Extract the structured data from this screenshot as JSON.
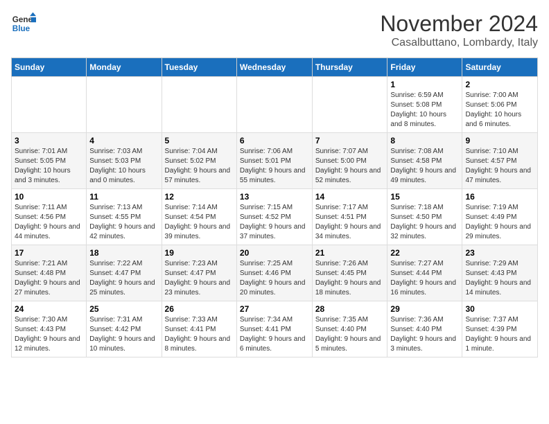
{
  "logo": {
    "line1": "General",
    "line2": "Blue"
  },
  "header": {
    "title": "November 2024",
    "subtitle": "Casalbuttano, Lombardy, Italy"
  },
  "weekdays": [
    "Sunday",
    "Monday",
    "Tuesday",
    "Wednesday",
    "Thursday",
    "Friday",
    "Saturday"
  ],
  "weeks": [
    [
      {
        "day": "",
        "info": ""
      },
      {
        "day": "",
        "info": ""
      },
      {
        "day": "",
        "info": ""
      },
      {
        "day": "",
        "info": ""
      },
      {
        "day": "",
        "info": ""
      },
      {
        "day": "1",
        "info": "Sunrise: 6:59 AM\nSunset: 5:08 PM\nDaylight: 10 hours and 8 minutes."
      },
      {
        "day": "2",
        "info": "Sunrise: 7:00 AM\nSunset: 5:06 PM\nDaylight: 10 hours and 6 minutes."
      }
    ],
    [
      {
        "day": "3",
        "info": "Sunrise: 7:01 AM\nSunset: 5:05 PM\nDaylight: 10 hours and 3 minutes."
      },
      {
        "day": "4",
        "info": "Sunrise: 7:03 AM\nSunset: 5:03 PM\nDaylight: 10 hours and 0 minutes."
      },
      {
        "day": "5",
        "info": "Sunrise: 7:04 AM\nSunset: 5:02 PM\nDaylight: 9 hours and 57 minutes."
      },
      {
        "day": "6",
        "info": "Sunrise: 7:06 AM\nSunset: 5:01 PM\nDaylight: 9 hours and 55 minutes."
      },
      {
        "day": "7",
        "info": "Sunrise: 7:07 AM\nSunset: 5:00 PM\nDaylight: 9 hours and 52 minutes."
      },
      {
        "day": "8",
        "info": "Sunrise: 7:08 AM\nSunset: 4:58 PM\nDaylight: 9 hours and 49 minutes."
      },
      {
        "day": "9",
        "info": "Sunrise: 7:10 AM\nSunset: 4:57 PM\nDaylight: 9 hours and 47 minutes."
      }
    ],
    [
      {
        "day": "10",
        "info": "Sunrise: 7:11 AM\nSunset: 4:56 PM\nDaylight: 9 hours and 44 minutes."
      },
      {
        "day": "11",
        "info": "Sunrise: 7:13 AM\nSunset: 4:55 PM\nDaylight: 9 hours and 42 minutes."
      },
      {
        "day": "12",
        "info": "Sunrise: 7:14 AM\nSunset: 4:54 PM\nDaylight: 9 hours and 39 minutes."
      },
      {
        "day": "13",
        "info": "Sunrise: 7:15 AM\nSunset: 4:52 PM\nDaylight: 9 hours and 37 minutes."
      },
      {
        "day": "14",
        "info": "Sunrise: 7:17 AM\nSunset: 4:51 PM\nDaylight: 9 hours and 34 minutes."
      },
      {
        "day": "15",
        "info": "Sunrise: 7:18 AM\nSunset: 4:50 PM\nDaylight: 9 hours and 32 minutes."
      },
      {
        "day": "16",
        "info": "Sunrise: 7:19 AM\nSunset: 4:49 PM\nDaylight: 9 hours and 29 minutes."
      }
    ],
    [
      {
        "day": "17",
        "info": "Sunrise: 7:21 AM\nSunset: 4:48 PM\nDaylight: 9 hours and 27 minutes."
      },
      {
        "day": "18",
        "info": "Sunrise: 7:22 AM\nSunset: 4:47 PM\nDaylight: 9 hours and 25 minutes."
      },
      {
        "day": "19",
        "info": "Sunrise: 7:23 AM\nSunset: 4:47 PM\nDaylight: 9 hours and 23 minutes."
      },
      {
        "day": "20",
        "info": "Sunrise: 7:25 AM\nSunset: 4:46 PM\nDaylight: 9 hours and 20 minutes."
      },
      {
        "day": "21",
        "info": "Sunrise: 7:26 AM\nSunset: 4:45 PM\nDaylight: 9 hours and 18 minutes."
      },
      {
        "day": "22",
        "info": "Sunrise: 7:27 AM\nSunset: 4:44 PM\nDaylight: 9 hours and 16 minutes."
      },
      {
        "day": "23",
        "info": "Sunrise: 7:29 AM\nSunset: 4:43 PM\nDaylight: 9 hours and 14 minutes."
      }
    ],
    [
      {
        "day": "24",
        "info": "Sunrise: 7:30 AM\nSunset: 4:43 PM\nDaylight: 9 hours and 12 minutes."
      },
      {
        "day": "25",
        "info": "Sunrise: 7:31 AM\nSunset: 4:42 PM\nDaylight: 9 hours and 10 minutes."
      },
      {
        "day": "26",
        "info": "Sunrise: 7:33 AM\nSunset: 4:41 PM\nDaylight: 9 hours and 8 minutes."
      },
      {
        "day": "27",
        "info": "Sunrise: 7:34 AM\nSunset: 4:41 PM\nDaylight: 9 hours and 6 minutes."
      },
      {
        "day": "28",
        "info": "Sunrise: 7:35 AM\nSunset: 4:40 PM\nDaylight: 9 hours and 5 minutes."
      },
      {
        "day": "29",
        "info": "Sunrise: 7:36 AM\nSunset: 4:40 PM\nDaylight: 9 hours and 3 minutes."
      },
      {
        "day": "30",
        "info": "Sunrise: 7:37 AM\nSunset: 4:39 PM\nDaylight: 9 hours and 1 minute."
      }
    ]
  ]
}
